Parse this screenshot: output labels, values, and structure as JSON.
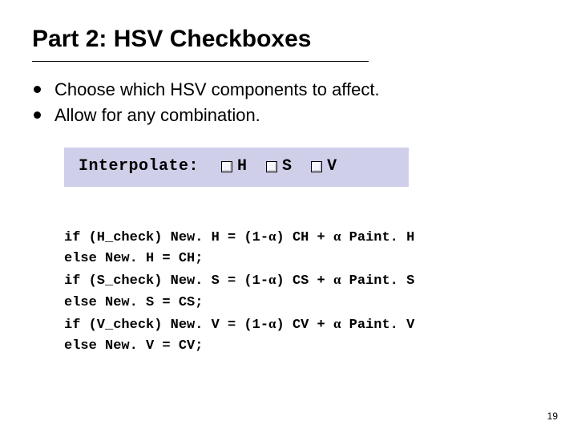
{
  "title": "Part 2: HSV Checkboxes",
  "bullets": [
    "Choose which HSV components to affect.",
    "Allow for any combination."
  ],
  "panel": {
    "label": "Interpolate:",
    "checkboxes": [
      {
        "name": "H",
        "checked": false
      },
      {
        "name": "S",
        "checked": false
      },
      {
        "name": "V",
        "checked": false
      }
    ]
  },
  "code": {
    "l1a": "if (H_check) New. H = (1-",
    "l1b": ") CH + ",
    "l1c": " Paint. H",
    "l2": "else New. H = CH;",
    "l3a": "if (S_check) New. S = (1-",
    "l3b": ") CS + ",
    "l3c": " Paint. S",
    "l4": "else New. S = CS;",
    "l5a": "if (V_check) New. V = (1-",
    "l5b": ") CV + ",
    "l5c": " Paint. V",
    "l6": "else New. V = CV;",
    "alpha": "α"
  },
  "page_number": "19"
}
